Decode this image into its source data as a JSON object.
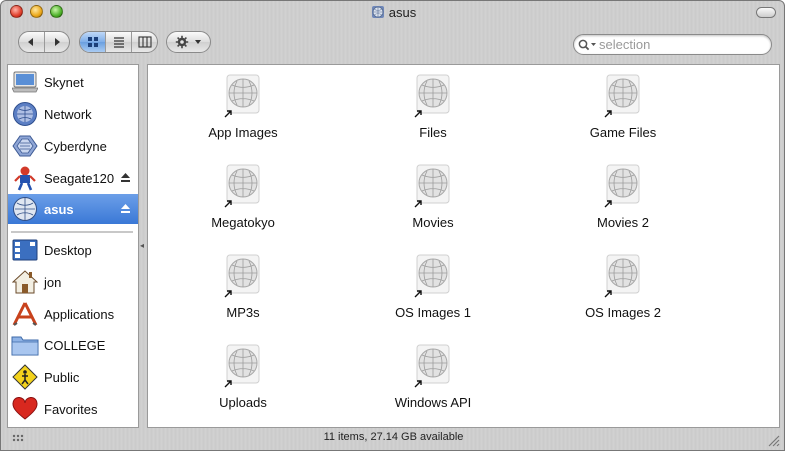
{
  "window": {
    "title": "asus"
  },
  "toolbar": {
    "back_label": "Back",
    "forward_label": "Forward",
    "view_icon_label": "Icon view",
    "view_list_label": "List view",
    "view_column_label": "Column view",
    "action_label": "Action"
  },
  "search": {
    "placeholder": "selection",
    "value": ""
  },
  "sidebar": {
    "devices": [
      {
        "label": "Skynet",
        "icon": "computer-icon"
      },
      {
        "label": "Network",
        "icon": "network-globe-icon"
      },
      {
        "label": "Cyberdyne",
        "icon": "server-icon"
      },
      {
        "label": "Seagate120",
        "icon": "robot-drive-icon",
        "ejectable": true
      },
      {
        "label": "asus",
        "icon": "network-volume-icon",
        "ejectable": true,
        "selected": true
      }
    ],
    "places": [
      {
        "label": "Desktop",
        "icon": "desktop-icon"
      },
      {
        "label": "jon",
        "icon": "home-icon"
      },
      {
        "label": "Applications",
        "icon": "applications-icon"
      },
      {
        "label": "COLLEGE",
        "icon": "folder-icon"
      },
      {
        "label": "Public",
        "icon": "public-sign-icon"
      },
      {
        "label": "Favorites",
        "icon": "heart-icon"
      }
    ]
  },
  "files": [
    {
      "name": "App Images"
    },
    {
      "name": "Files"
    },
    {
      "name": "Game Files"
    },
    {
      "name": "Megatokyo"
    },
    {
      "name": "Movies"
    },
    {
      "name": "Movies 2"
    },
    {
      "name": "MP3s"
    },
    {
      "name": "OS Images 1"
    },
    {
      "name": "OS Images 2"
    },
    {
      "name": "Uploads"
    },
    {
      "name": "Windows API"
    }
  ],
  "status": {
    "text": "11 items, 27.14 GB available"
  },
  "colors": {
    "selection": "#3a78d6",
    "window_bg": "#cbcbcb",
    "content_bg": "#ffffff"
  }
}
